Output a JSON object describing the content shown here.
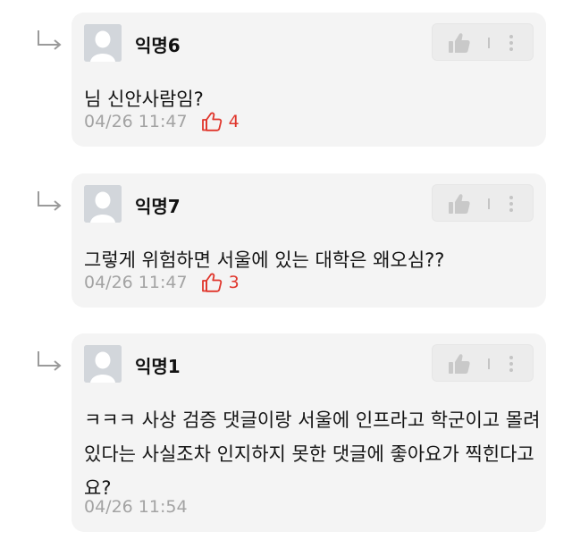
{
  "comments": [
    {
      "nickname": "익명6",
      "text": "님 신안사람임?",
      "datetime": "04/26 11:47",
      "likes": "4"
    },
    {
      "nickname": "익명7",
      "text": "그렇게 위험하면 서울에 있는 대학은 왜오심??",
      "datetime": "04/26 11:47",
      "likes": "3"
    },
    {
      "nickname": "익명1",
      "text": "ㅋㅋㅋ 사상 검증 댓글이랑 서울에 인프라고 학군이고 몰려있다는 사실조차 인지하지 못한 댓글에 좋아요가 찍힌다고요?",
      "datetime": "04/26 11:54",
      "likes": ""
    }
  ],
  "icons": {
    "reply": "reply-arrow-icon",
    "avatar": "default-avatar-icon",
    "like": "thumbs-up-icon",
    "more": "more-vertical-icon",
    "liked": "thumbs-up-outline-icon"
  },
  "colors": {
    "card_bg": "#f4f4f4",
    "like_accent": "#e0352b",
    "meta_gray": "#a3a3a3"
  }
}
